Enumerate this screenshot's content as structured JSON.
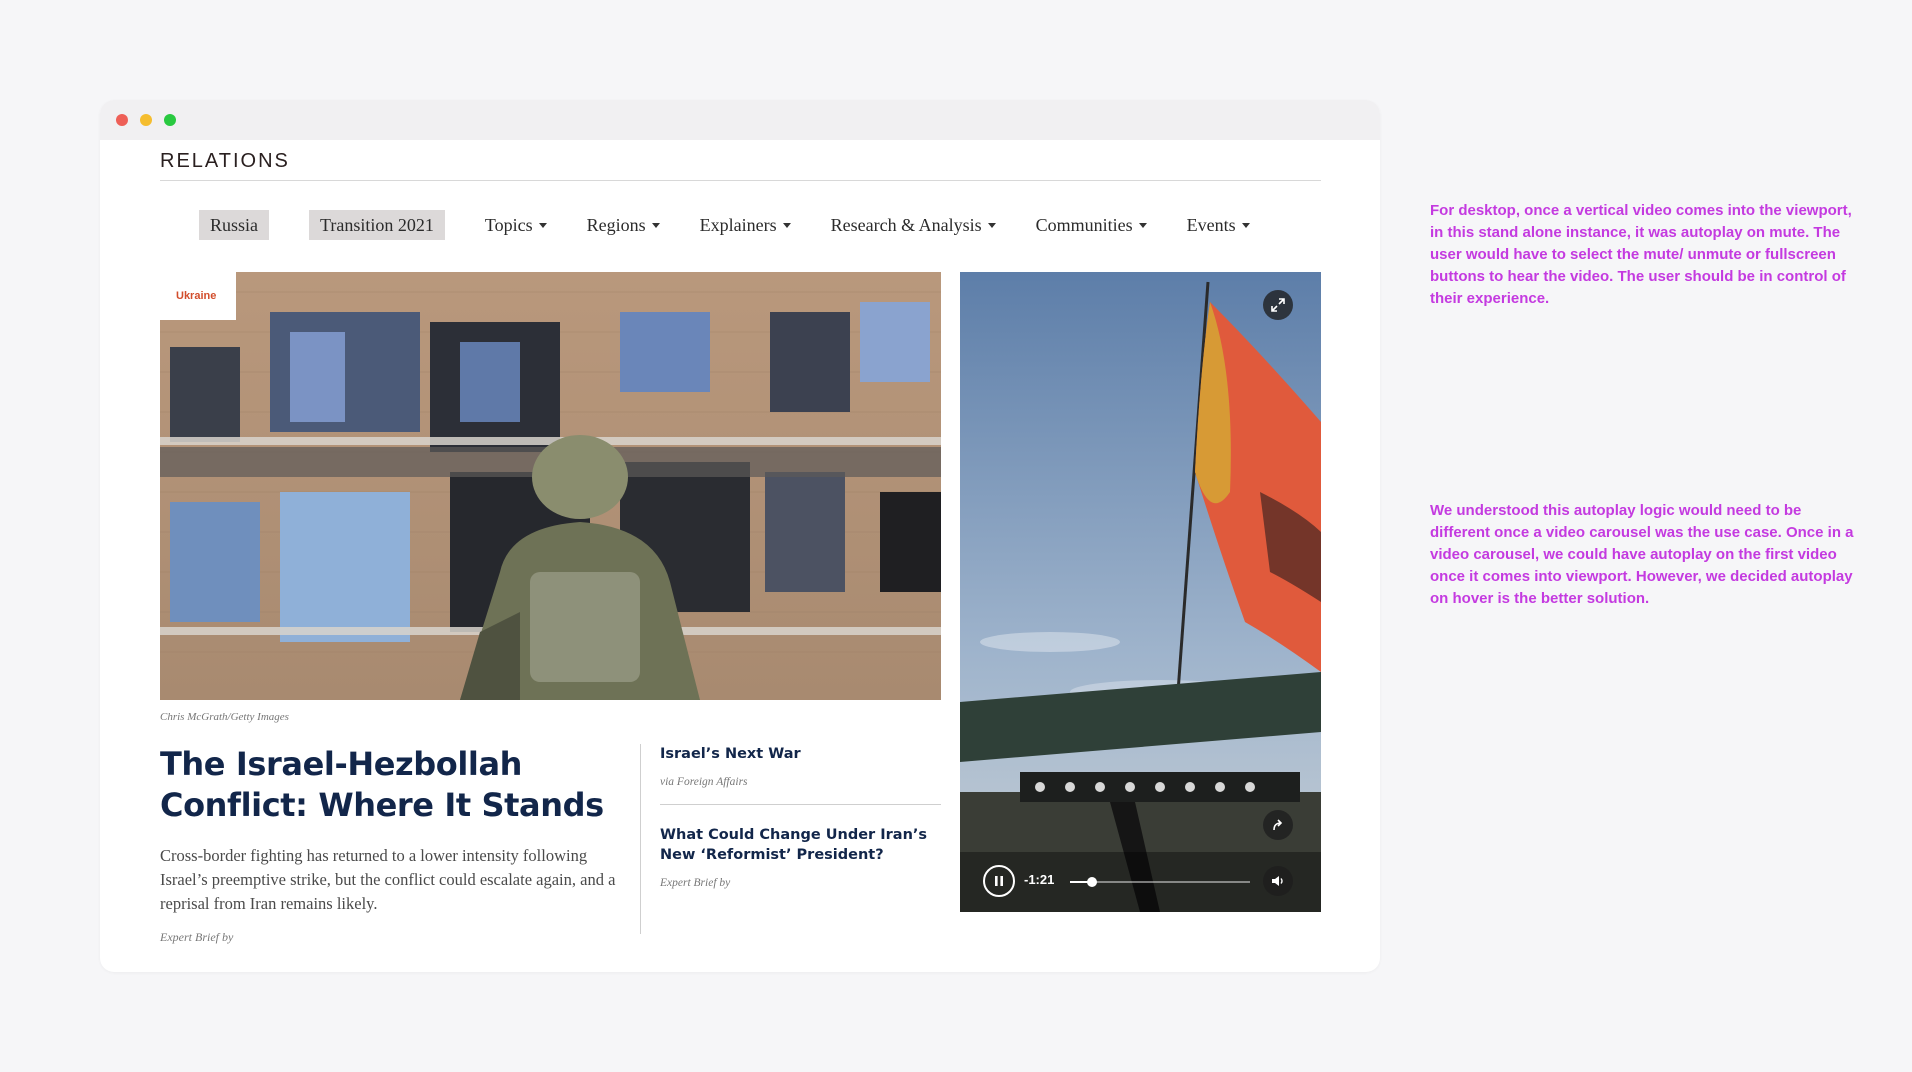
{
  "site": {
    "logo": "RELATIONS"
  },
  "nav": {
    "pills": [
      "Russia",
      "Transition 2021"
    ],
    "menus": [
      "Topics",
      "Regions",
      "Explainers",
      "Research & Analysis",
      "Communities",
      "Events"
    ]
  },
  "hero": {
    "tag": "Ukraine",
    "credit": "Chris McGrath/Getty Images"
  },
  "main_story": {
    "headline": "The Israel-Hezbollah Conflict: Where It Stands",
    "dek": "Cross-border fighting has returned to a lower intensity following Israel’s preemptive strike, but the conflict could escalate again, and a reprisal from Iran remains likely.",
    "byline": "Expert Brief by"
  },
  "side_stories": [
    {
      "title": "Israel’s Next War",
      "via": "via Foreign Affairs"
    },
    {
      "title": "What Could Change Under Iran’s New ‘Reformist’ President?",
      "via": "Expert Brief by"
    }
  ],
  "video": {
    "time_remaining": "-1:21",
    "progress": 0.12,
    "icons": [
      "fullscreen-icon",
      "share-icon",
      "pause-icon",
      "volume-icon"
    ]
  },
  "annotations": [
    "For desktop, once a vertical video comes into the viewport, in this stand alone instance, it was autoplay on mute. The user would have to select the mute/ unmute or fullscreen buttons to hear the video. The user should be in control of their experience.",
    "We understood this autoplay logic would need to be different once a video carousel was the use case. Once in a video carousel, we could have autoplay on the first video once it comes into viewport. However, we decided autoplay on hover is the better solution."
  ],
  "colors": {
    "headline": "#12264a",
    "tag": "#d24e2c",
    "annotation": "#c43ae0",
    "pill_bg": "#dcd9d9"
  }
}
